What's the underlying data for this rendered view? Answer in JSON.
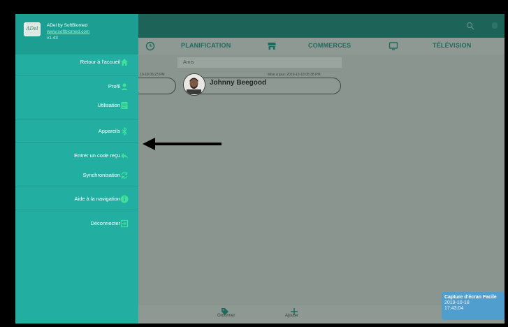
{
  "drawer": {
    "app_name": "ADel by SoftBiomed",
    "app_url": "www.softbiomed.com",
    "version": "v1.43",
    "logo_text": "ADel",
    "items": [
      {
        "label": "Retour à l'accueil",
        "icon": "home-icon"
      },
      {
        "label": "Profil",
        "icon": "person-icon"
      },
      {
        "label": "Utilisation",
        "icon": "document-icon"
      },
      {
        "label": "Appareils",
        "icon": "bluetooth-icon"
      },
      {
        "label": "Entrer un code reçu",
        "icon": "reply-arrow-icon"
      },
      {
        "label": "Synchronisation",
        "icon": "sync-icon"
      },
      {
        "label": "Aide à la navigation",
        "icon": "info-icon"
      },
      {
        "label": "Déconnecter",
        "icon": "logout-icon"
      }
    ]
  },
  "tabs": [
    {
      "label": "PLANIFICATION",
      "icon": "clock-icon"
    },
    {
      "label": "COMMERCES",
      "icon": "store-icon"
    },
    {
      "label": "TÉLÉVISION",
      "icon": "tv-icon"
    }
  ],
  "contacts": {
    "section_title": "Amis",
    "left_timestamp": "10-18 05:23 PM",
    "name": "Johnny Beegood",
    "update_text": "Mise à jour: 2019-10-18 05:38 PM"
  },
  "bottom_bar": {
    "ordonner_label": "Ordonner",
    "ajouter_label": "Ajouter"
  },
  "toast": {
    "line1": "Capture d'écran Facile",
    "line2": "2019-10-18",
    "line3": "17:43:04"
  },
  "colors": {
    "drawer": "#22afa2",
    "accent_icon": "#3ee09a",
    "topbar": "#1e6357"
  }
}
